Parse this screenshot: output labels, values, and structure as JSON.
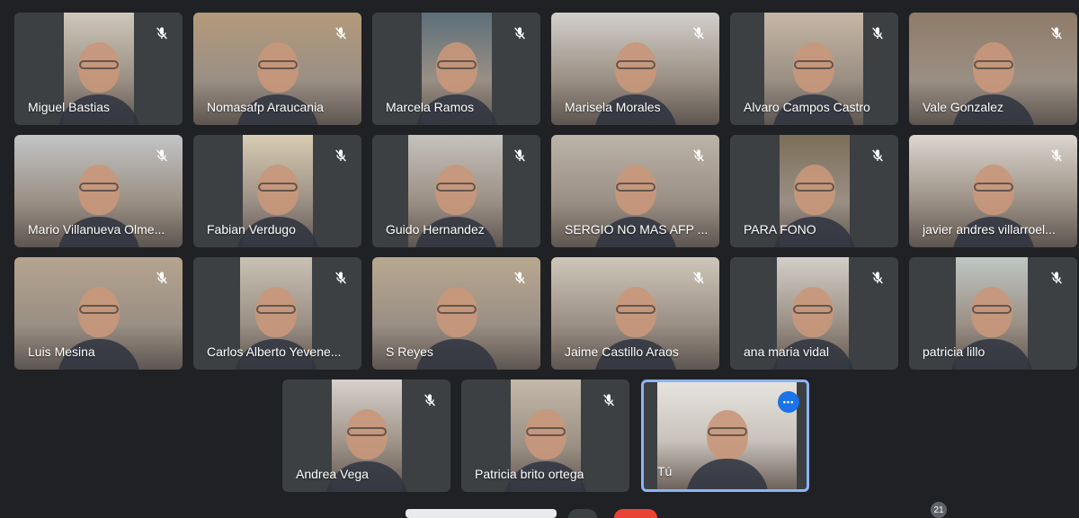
{
  "participants": [
    {
      "name": "Miguel Bastias"
    },
    {
      "name": "Nomasafp Araucania"
    },
    {
      "name": "Marcela Ramos"
    },
    {
      "name": "Marisela Morales"
    },
    {
      "name": "Alvaro Campos Castro"
    },
    {
      "name": "Vale Gonzalez"
    },
    {
      "name": "Mario Villanueva Olme..."
    },
    {
      "name": "Fabian Verdugo"
    },
    {
      "name": "Guido Hernandez"
    },
    {
      "name": "SERGIO NO MAS AFP ..."
    },
    {
      "name": "PARA FONO"
    },
    {
      "name": "javier andres villarroel..."
    },
    {
      "name": "Luis Mesina"
    },
    {
      "name": "Carlos Alberto Yevene..."
    },
    {
      "name": "S Reyes"
    },
    {
      "name": "Jaime Castillo Araos"
    },
    {
      "name": "ana maria vidal"
    },
    {
      "name": "patricia lillo"
    },
    {
      "name": "Andrea Vega"
    },
    {
      "name": "Patricia brito ortega"
    }
  ],
  "self": {
    "name": "Tú",
    "menu_icon": "more-options-icon",
    "accent": "#8ab4f8"
  },
  "participant_count": "21",
  "icons": {
    "muted": "mic-off-icon"
  },
  "colors": {
    "background": "#202124",
    "tile": "#3c4043",
    "leave": "#ea4335"
  }
}
